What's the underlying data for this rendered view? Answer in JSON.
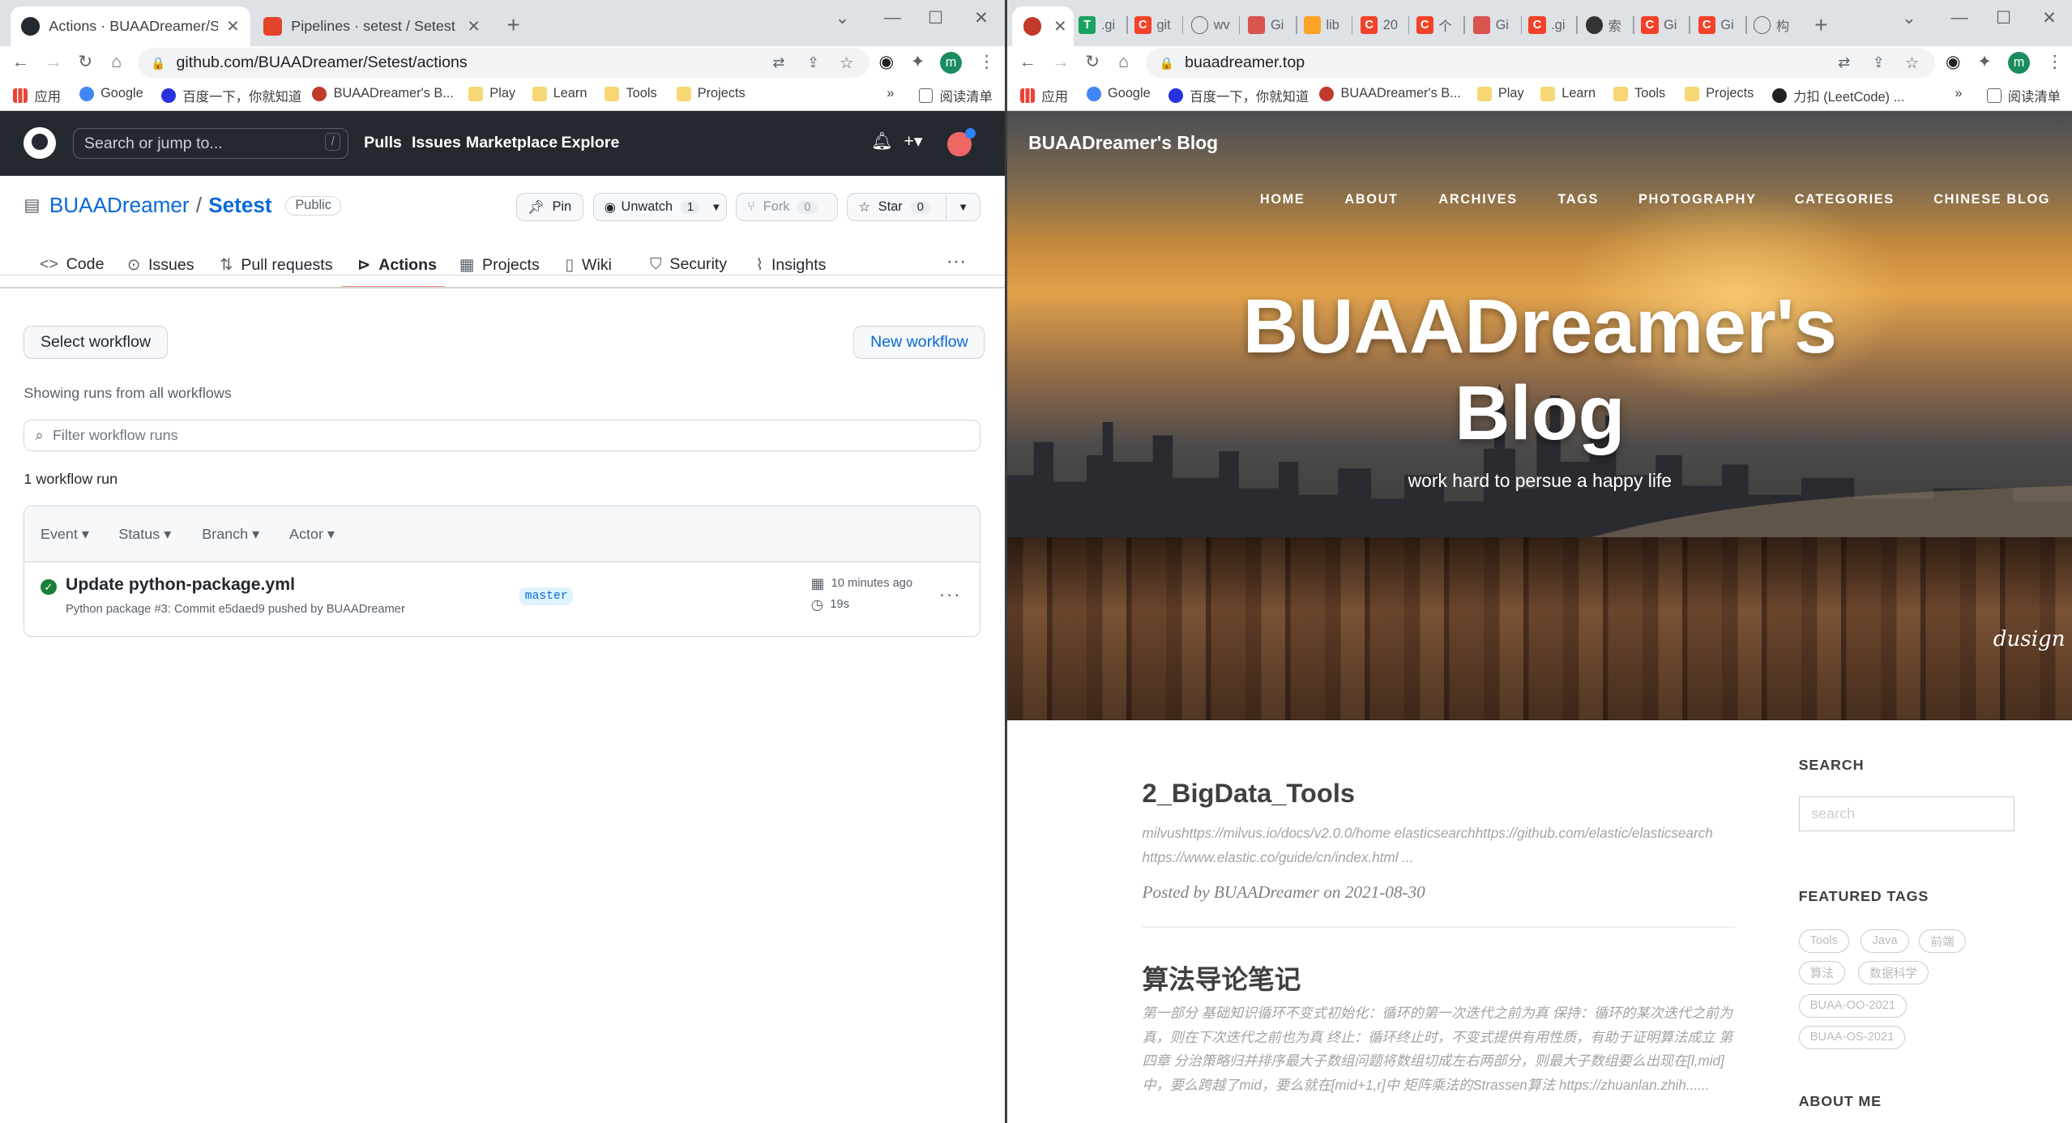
{
  "left_browser": {
    "tabs": [
      {
        "title": "Actions · BUAADreamer/Setest",
        "active": true
      },
      {
        "title": "Pipelines · setest / Setest · Git",
        "active": false
      }
    ],
    "url": "github.com/BUAADreamer/Setest/actions",
    "bookmarks": [
      "应用",
      "Google",
      "百度一下，你就知道",
      "BUAADreamer's B...",
      "Play",
      "Learn",
      "Tools",
      "Projects"
    ],
    "reading_list": "阅读清单",
    "profile_initial": "m"
  },
  "github": {
    "search_placeholder": "Search or jump to...",
    "search_key": "/",
    "nav": [
      "Pulls",
      "Issues",
      "Marketplace",
      "Explore"
    ],
    "owner": "BUAADreamer",
    "separator": "/",
    "repo": "Setest",
    "visibility": "Public",
    "pin_label": "Pin",
    "watch_label": "Unwatch",
    "watch_count": "1",
    "fork_label": "Fork",
    "fork_count": "0",
    "star_label": "Star",
    "star_count": "0",
    "tabs": [
      "Code",
      "Issues",
      "Pull requests",
      "Actions",
      "Projects",
      "Wiki",
      "Security",
      "Insights"
    ],
    "active_tab": "Actions",
    "select_workflow": "Select workflow",
    "new_workflow": "New workflow",
    "showing_text": "Showing runs from all workflows",
    "filter_placeholder": "Filter workflow runs",
    "runs_count": "1 workflow run",
    "filters": [
      "Event",
      "Status",
      "Branch",
      "Actor"
    ],
    "run": {
      "title": "Update python-package.yml",
      "workflow": "Python package",
      "detail": "#3: Commit e5daed9 pushed by BUAADreamer",
      "branch": "master",
      "time": "10 minutes ago",
      "duration": "19s",
      "status": "success"
    }
  },
  "right_browser": {
    "url": "buaadreamer.top",
    "mini_tabs": [
      ".gi",
      "git",
      "wv",
      "Gi",
      "lib",
      "20",
      "个",
      "Gi",
      ".gi",
      "索",
      "Gi",
      "Gi",
      "构"
    ],
    "bookmarks": [
      "应用",
      "Google",
      "百度一下，你就知道",
      "BUAADreamer's B...",
      "Play",
      "Learn",
      "Tools",
      "Projects",
      "力扣 (LeetCode) ..."
    ],
    "reading_list": "阅读清单",
    "profile_initial": "m"
  },
  "blog": {
    "brand": "BUAADreamer's Blog",
    "nav": [
      "HOME",
      "ABOUT",
      "ARCHIVES",
      "TAGS",
      "PHOTOGRAPHY",
      "CATEGORIES",
      "CHINESE BLOG"
    ],
    "title_line1": "BUAADreamer's",
    "title_line2": "Blog",
    "tagline": "work hard to persue a happy life",
    "signature": "dusign",
    "posts": [
      {
        "title": "2_BigData_Tools",
        "excerpt": "milvushttps://milvus.io/docs/v2.0.0/home elasticsearchhttps://github.com/elastic/elasticsearch https://www.elastic.co/guide/cn/index.html ...",
        "meta": "Posted by BUAADreamer on 2021-08-30"
      },
      {
        "title": "算法导论笔记",
        "excerpt": "第一部分 基础知识循环不变式初始化：循环的第一次迭代之前为真 保持：循环的某次迭代之前为真，则在下次迭代之前也为真 终止：循环终止时，不变式提供有用性质，有助于证明算法成立 第四章 分治策略归并排序最大子数组问题将数组切成左右两部分，则最大子数组要么出现在[l,mid]中，要么跨越了mid，要么就在[mid+1,r]中 矩阵乘法的Strassen算法 https://zhuanlan.zhih......"
      }
    ],
    "sidebar": {
      "search_heading": "SEARCH",
      "search_placeholder": "search",
      "featured_heading": "FEATURED TAGS",
      "tags": [
        "Tools",
        "Java",
        "前端",
        "算法",
        "数据科学",
        "BUAA-OO-2021",
        "BUAA-OS-2021"
      ],
      "about_heading": "ABOUT ME"
    }
  }
}
